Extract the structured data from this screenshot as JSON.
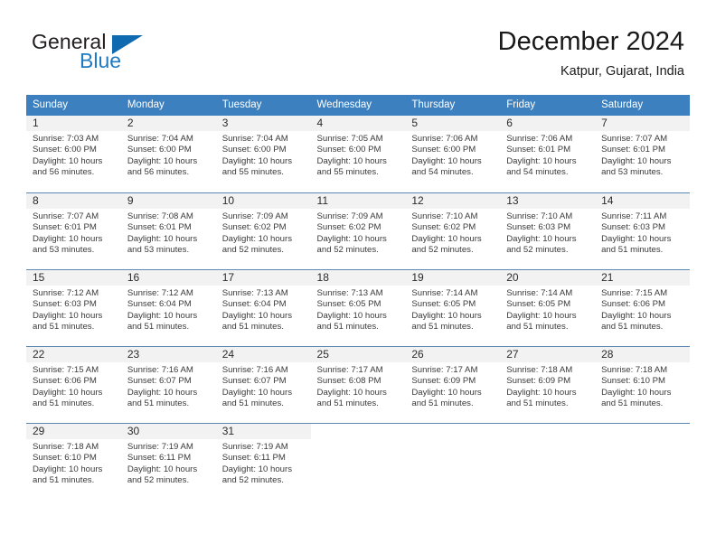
{
  "brand": {
    "word1": "General",
    "word2": "Blue",
    "flag_color": "#0f6ab0",
    "text_color": "#231f20",
    "blue_color": "#1f7ac0"
  },
  "header": {
    "title": "December 2024",
    "subtitle": "Katpur, Gujarat, India"
  },
  "theme": {
    "header_bg": "#3d80bf",
    "daynum_bg": "#f2f2f2",
    "separator": "#5c87b2"
  },
  "weekdays": [
    "Sunday",
    "Monday",
    "Tuesday",
    "Wednesday",
    "Thursday",
    "Friday",
    "Saturday"
  ],
  "weeks": [
    [
      {
        "day": "1",
        "sunrise": "Sunrise: 7:03 AM",
        "sunset": "Sunset: 6:00 PM",
        "daylight1": "Daylight: 10 hours",
        "daylight2": "and 56 minutes."
      },
      {
        "day": "2",
        "sunrise": "Sunrise: 7:04 AM",
        "sunset": "Sunset: 6:00 PM",
        "daylight1": "Daylight: 10 hours",
        "daylight2": "and 56 minutes."
      },
      {
        "day": "3",
        "sunrise": "Sunrise: 7:04 AM",
        "sunset": "Sunset: 6:00 PM",
        "daylight1": "Daylight: 10 hours",
        "daylight2": "and 55 minutes."
      },
      {
        "day": "4",
        "sunrise": "Sunrise: 7:05 AM",
        "sunset": "Sunset: 6:00 PM",
        "daylight1": "Daylight: 10 hours",
        "daylight2": "and 55 minutes."
      },
      {
        "day": "5",
        "sunrise": "Sunrise: 7:06 AM",
        "sunset": "Sunset: 6:00 PM",
        "daylight1": "Daylight: 10 hours",
        "daylight2": "and 54 minutes."
      },
      {
        "day": "6",
        "sunrise": "Sunrise: 7:06 AM",
        "sunset": "Sunset: 6:01 PM",
        "daylight1": "Daylight: 10 hours",
        "daylight2": "and 54 minutes."
      },
      {
        "day": "7",
        "sunrise": "Sunrise: 7:07 AM",
        "sunset": "Sunset: 6:01 PM",
        "daylight1": "Daylight: 10 hours",
        "daylight2": "and 53 minutes."
      }
    ],
    [
      {
        "day": "8",
        "sunrise": "Sunrise: 7:07 AM",
        "sunset": "Sunset: 6:01 PM",
        "daylight1": "Daylight: 10 hours",
        "daylight2": "and 53 minutes."
      },
      {
        "day": "9",
        "sunrise": "Sunrise: 7:08 AM",
        "sunset": "Sunset: 6:01 PM",
        "daylight1": "Daylight: 10 hours",
        "daylight2": "and 53 minutes."
      },
      {
        "day": "10",
        "sunrise": "Sunrise: 7:09 AM",
        "sunset": "Sunset: 6:02 PM",
        "daylight1": "Daylight: 10 hours",
        "daylight2": "and 52 minutes."
      },
      {
        "day": "11",
        "sunrise": "Sunrise: 7:09 AM",
        "sunset": "Sunset: 6:02 PM",
        "daylight1": "Daylight: 10 hours",
        "daylight2": "and 52 minutes."
      },
      {
        "day": "12",
        "sunrise": "Sunrise: 7:10 AM",
        "sunset": "Sunset: 6:02 PM",
        "daylight1": "Daylight: 10 hours",
        "daylight2": "and 52 minutes."
      },
      {
        "day": "13",
        "sunrise": "Sunrise: 7:10 AM",
        "sunset": "Sunset: 6:03 PM",
        "daylight1": "Daylight: 10 hours",
        "daylight2": "and 52 minutes."
      },
      {
        "day": "14",
        "sunrise": "Sunrise: 7:11 AM",
        "sunset": "Sunset: 6:03 PM",
        "daylight1": "Daylight: 10 hours",
        "daylight2": "and 51 minutes."
      }
    ],
    [
      {
        "day": "15",
        "sunrise": "Sunrise: 7:12 AM",
        "sunset": "Sunset: 6:03 PM",
        "daylight1": "Daylight: 10 hours",
        "daylight2": "and 51 minutes."
      },
      {
        "day": "16",
        "sunrise": "Sunrise: 7:12 AM",
        "sunset": "Sunset: 6:04 PM",
        "daylight1": "Daylight: 10 hours",
        "daylight2": "and 51 minutes."
      },
      {
        "day": "17",
        "sunrise": "Sunrise: 7:13 AM",
        "sunset": "Sunset: 6:04 PM",
        "daylight1": "Daylight: 10 hours",
        "daylight2": "and 51 minutes."
      },
      {
        "day": "18",
        "sunrise": "Sunrise: 7:13 AM",
        "sunset": "Sunset: 6:05 PM",
        "daylight1": "Daylight: 10 hours",
        "daylight2": "and 51 minutes."
      },
      {
        "day": "19",
        "sunrise": "Sunrise: 7:14 AM",
        "sunset": "Sunset: 6:05 PM",
        "daylight1": "Daylight: 10 hours",
        "daylight2": "and 51 minutes."
      },
      {
        "day": "20",
        "sunrise": "Sunrise: 7:14 AM",
        "sunset": "Sunset: 6:05 PM",
        "daylight1": "Daylight: 10 hours",
        "daylight2": "and 51 minutes."
      },
      {
        "day": "21",
        "sunrise": "Sunrise: 7:15 AM",
        "sunset": "Sunset: 6:06 PM",
        "daylight1": "Daylight: 10 hours",
        "daylight2": "and 51 minutes."
      }
    ],
    [
      {
        "day": "22",
        "sunrise": "Sunrise: 7:15 AM",
        "sunset": "Sunset: 6:06 PM",
        "daylight1": "Daylight: 10 hours",
        "daylight2": "and 51 minutes."
      },
      {
        "day": "23",
        "sunrise": "Sunrise: 7:16 AM",
        "sunset": "Sunset: 6:07 PM",
        "daylight1": "Daylight: 10 hours",
        "daylight2": "and 51 minutes."
      },
      {
        "day": "24",
        "sunrise": "Sunrise: 7:16 AM",
        "sunset": "Sunset: 6:07 PM",
        "daylight1": "Daylight: 10 hours",
        "daylight2": "and 51 minutes."
      },
      {
        "day": "25",
        "sunrise": "Sunrise: 7:17 AM",
        "sunset": "Sunset: 6:08 PM",
        "daylight1": "Daylight: 10 hours",
        "daylight2": "and 51 minutes."
      },
      {
        "day": "26",
        "sunrise": "Sunrise: 7:17 AM",
        "sunset": "Sunset: 6:09 PM",
        "daylight1": "Daylight: 10 hours",
        "daylight2": "and 51 minutes."
      },
      {
        "day": "27",
        "sunrise": "Sunrise: 7:18 AM",
        "sunset": "Sunset: 6:09 PM",
        "daylight1": "Daylight: 10 hours",
        "daylight2": "and 51 minutes."
      },
      {
        "day": "28",
        "sunrise": "Sunrise: 7:18 AM",
        "sunset": "Sunset: 6:10 PM",
        "daylight1": "Daylight: 10 hours",
        "daylight2": "and 51 minutes."
      }
    ],
    [
      {
        "day": "29",
        "sunrise": "Sunrise: 7:18 AM",
        "sunset": "Sunset: 6:10 PM",
        "daylight1": "Daylight: 10 hours",
        "daylight2": "and 51 minutes."
      },
      {
        "day": "30",
        "sunrise": "Sunrise: 7:19 AM",
        "sunset": "Sunset: 6:11 PM",
        "daylight1": "Daylight: 10 hours",
        "daylight2": "and 52 minutes."
      },
      {
        "day": "31",
        "sunrise": "Sunrise: 7:19 AM",
        "sunset": "Sunset: 6:11 PM",
        "daylight1": "Daylight: 10 hours",
        "daylight2": "and 52 minutes."
      },
      {
        "day": "",
        "sunrise": "",
        "sunset": "",
        "daylight1": "",
        "daylight2": ""
      },
      {
        "day": "",
        "sunrise": "",
        "sunset": "",
        "daylight1": "",
        "daylight2": ""
      },
      {
        "day": "",
        "sunrise": "",
        "sunset": "",
        "daylight1": "",
        "daylight2": ""
      },
      {
        "day": "",
        "sunrise": "",
        "sunset": "",
        "daylight1": "",
        "daylight2": ""
      }
    ]
  ]
}
